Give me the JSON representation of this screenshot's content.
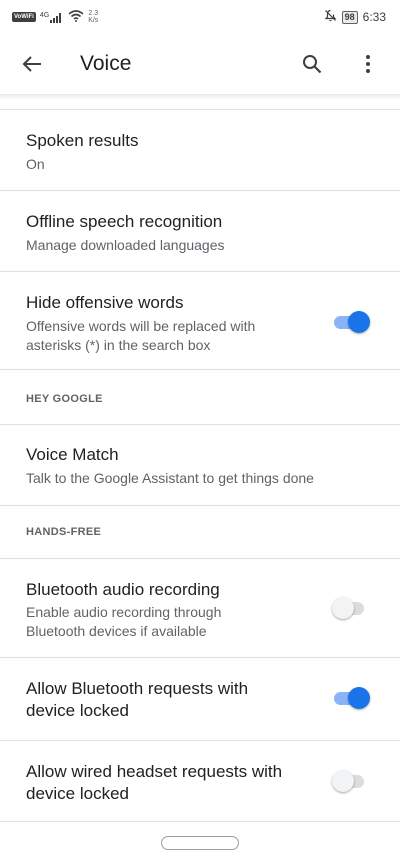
{
  "status_bar": {
    "carrier_badge": "VoWiFi",
    "network_signal": "4G",
    "data_speed_value": "2.3",
    "data_speed_unit": "K/s",
    "battery_level": "98",
    "time": "6:33"
  },
  "app_bar": {
    "title": "Voice"
  },
  "settings": [
    {
      "title": "Spoken results",
      "subtitle": "On"
    },
    {
      "title": "Offline speech recognition",
      "subtitle": "Manage downloaded languages"
    },
    {
      "title": "Hide offensive words",
      "subtitle_line1": "Offensive words will be replaced with",
      "subtitle_line2": "asterisks (*) in the search box",
      "toggle_on": true
    }
  ],
  "sections": {
    "hey_google": {
      "header": "HEY GOOGLE",
      "voice_match": {
        "title": "Voice Match",
        "subtitle": "Talk to the Google Assistant to get things done"
      }
    },
    "hands_free": {
      "header": "HANDS-FREE",
      "bluetooth_recording": {
        "title": "Bluetooth audio recording",
        "subtitle_line1": "Enable audio recording through",
        "subtitle_line2": "Bluetooth devices if available",
        "toggle_on": false
      },
      "bluetooth_requests": {
        "title_line1": "Allow Bluetooth requests with",
        "title_line2": "device locked",
        "toggle_on": true
      },
      "wired_headset": {
        "title_line1": "Allow wired headset requests with",
        "title_line2": "device locked",
        "toggle_on": false
      }
    }
  },
  "colors": {
    "toggle_on_thumb": "#1a73e8",
    "toggle_on_track": "#8ab4f8",
    "toggle_off_thumb": "#f1f3f4",
    "toggle_off_track": "#dadce0"
  },
  "icons": [
    "back-arrow-icon",
    "search-icon",
    "more-vert-icon",
    "signal-icon",
    "wifi-icon",
    "do-not-disturb-icon",
    "battery-icon"
  ]
}
